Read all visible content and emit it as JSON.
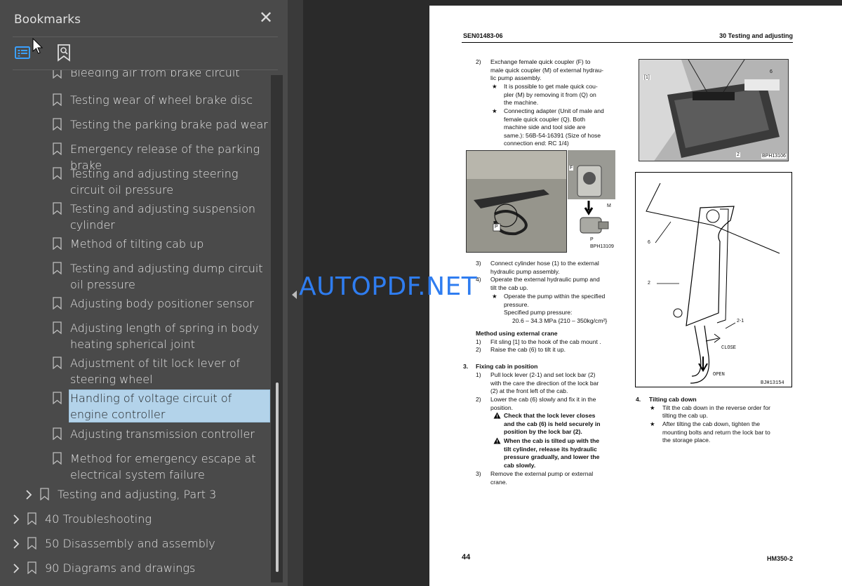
{
  "panel": {
    "title": "Bookmarks",
    "close_glyph": "✕",
    "toolbar": {
      "list_icon": "bookmark-list-icon",
      "search_icon": "bookmark-search-icon"
    }
  },
  "bookmarks": [
    {
      "label": "Bleeding air from brake circuit",
      "level": 2
    },
    {
      "label": "Testing wear of wheel brake disc",
      "level": 2
    },
    {
      "label": "Testing the parking brake pad wear",
      "level": 2
    },
    {
      "label": "Emergency release of the parking brake",
      "level": 2
    },
    {
      "label": "Testing and adjusting steering circuit oil pressure",
      "level": 2
    },
    {
      "label": "Testing and adjusting suspension cylinder",
      "level": 2
    },
    {
      "label": "Method of tilting cab up",
      "level": 2
    },
    {
      "label": "Testing and adjusting dump circuit oil pressure",
      "level": 2
    },
    {
      "label": "Adjusting body positioner sensor",
      "level": 2
    },
    {
      "label": "Adjusting length of spring in body heating spherical joint",
      "level": 2
    },
    {
      "label": "Adjustment of tilt lock lever of steering wheel",
      "level": 2
    },
    {
      "label": "Handling of voltage circuit of engine controller",
      "level": 2,
      "selected": true
    },
    {
      "label": "Adjusting transmission controller",
      "level": 2
    },
    {
      "label": "Method for emergency escape at electrical system failure",
      "level": 2
    },
    {
      "label": "Testing and adjusting, Part 3",
      "level": 1,
      "collapsed": true
    },
    {
      "label": "40 Troubleshooting",
      "level": 0,
      "collapsed": true
    },
    {
      "label": "50 Disassembly and assembly",
      "level": 0,
      "collapsed": true
    },
    {
      "label": "90 Diagrams and drawings",
      "level": 0,
      "collapsed": true
    }
  ],
  "watermark": "AUTOPDF.NET",
  "page": {
    "header_left": "SEN01483-06",
    "header_right": "30 Testing and adjusting",
    "page_number": "44",
    "model": "HM350-2",
    "col1": {
      "step2_num": "2)",
      "step2": [
        "Exchange female quick coupler (F) to",
        "male quick coupler (M) of external hydrau-",
        "lic pump assembly."
      ],
      "star1": [
        "It is possible to get male quick cou-",
        "pler (M) by removing it from (Q) on",
        "the machine."
      ],
      "star2": [
        "Connecting adapter (Unit of male and",
        "female quick coupler (Q). Both",
        "machine side and tool side are",
        "same.): 56B-54-16391 (Size of hose",
        "connection end: RC 1/4)"
      ],
      "fig1_code": "BPH13109",
      "fig1_labels": {
        "f": "F",
        "m": "M",
        "p": "P"
      },
      "step3_num": "3)",
      "step3": [
        "Connect cylinder hose (1) to the external",
        "hydraulic pump assembly."
      ],
      "step4_num": "4)",
      "step4": [
        "Operate the external hydraulic pump and",
        "tilt the cab up."
      ],
      "star3": [
        "Operate the pump within the specified",
        "pressure."
      ],
      "spec_label": "Specified pump pressure:",
      "spec_value": "20.6 – 34.3 MPa {210 – 350kg/cm²}",
      "crane_heading": "Method using external crane",
      "crane1_num": "1)",
      "crane1": "Fit sling [1] to the hook of the cab mount .",
      "crane2_num": "2)",
      "crane2": "Raise the cab (6) to tilt it up.",
      "fix_num": "3.",
      "fix_heading": "Fixing cab in position",
      "fix1_num": "1)",
      "fix1": [
        "Pull lock lever (2-1) and set lock bar (2)",
        "with the care the direction of the lock bar",
        "(2) at the front left of the cab."
      ],
      "fix2_num": "2)",
      "fix2": [
        "Lower the cab (6) slowly and fix it in the",
        "position."
      ],
      "warn1": [
        "Check that the lock lever closes",
        "and the cab (6) is held securely in",
        "position by the lock bar (2)."
      ],
      "warn2": [
        "When the cab is tilted up with the",
        "tilt cylinder, release its hydraulic",
        "pressure gradually, and lower the",
        "cab slowly."
      ],
      "fix3_num": "3)",
      "fix3": [
        "Remove the external pump or external",
        "crane."
      ]
    },
    "col2": {
      "fig2_code": "BPH13106",
      "fig2_labels": {
        "sling": "[1]",
        "cab": "6",
        "bar": "2"
      },
      "fig3_code": "BJH13154",
      "fig3_labels": {
        "cab": "6",
        "bar": "2",
        "lever": "2-1",
        "close": "CLOSE",
        "open": "OPEN"
      },
      "tilt_num": "4.",
      "tilt_heading": "Tilting cab down",
      "tilt_star1": [
        "Tilt the cab down in the reverse order for",
        "tilting the cab up."
      ],
      "tilt_star2": [
        "After tilting the cab down, tighten the",
        "mounting bolts and return the lock bar to",
        "the storage place."
      ]
    }
  }
}
